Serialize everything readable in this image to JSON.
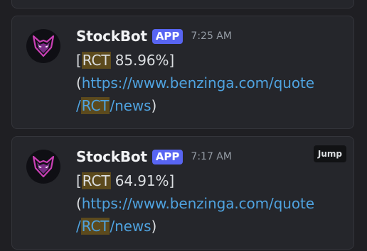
{
  "messages": [
    {
      "username": "StockBot",
      "badge": "APP",
      "time": "7:25 AM",
      "open_bracket": "[",
      "ticker": "RCT",
      "change": " 85.96%]",
      "paren_open": "(",
      "link_part1": "https://www.benzinga.com/quote",
      "link_slash": "/",
      "link_ticker": "RCT",
      "link_part2": "/news",
      "paren_close": ")"
    },
    {
      "username": "StockBot",
      "badge": "APP",
      "time": "7:17 AM",
      "open_bracket": "[",
      "ticker": "RCT",
      "change": " 64.91%]",
      "paren_open": "(",
      "link_part1": "https://www.benzinga.com/quote",
      "link_slash": "/",
      "link_ticker": "RCT",
      "link_part2": "/news",
      "paren_close": ")",
      "jump_label": "Jump"
    }
  ],
  "avatar_icon": "fox-mask-icon",
  "colors": {
    "background": "#1f1f23",
    "card": "#25262b",
    "badge": "#5865f2",
    "link": "#4fa3e0",
    "highlight": "#5c4a1d"
  }
}
